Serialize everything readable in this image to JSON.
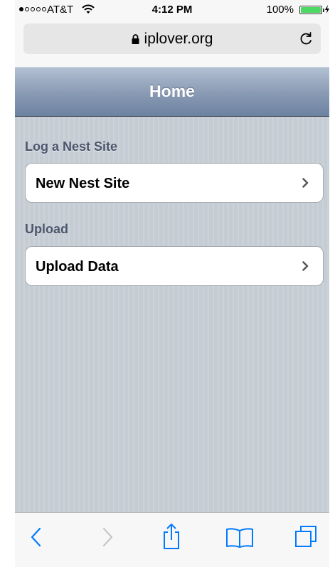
{
  "status_bar": {
    "carrier": "AT&T",
    "time": "4:12 PM",
    "battery_percent": "100%",
    "battery_level": 1.0,
    "signal_filled": 1,
    "signal_total": 5
  },
  "address_bar": {
    "url": "iplover.org",
    "lock_icon": "lock-icon",
    "reload_icon": "reload-icon"
  },
  "header": {
    "title": "Home"
  },
  "sections": [
    {
      "header": "Log a Nest Site",
      "item_label": "New Nest Site"
    },
    {
      "header": "Upload",
      "item_label": "Upload Data"
    }
  ],
  "toolbar": {
    "buttons": [
      "back-icon",
      "forward-icon",
      "share-icon",
      "bookmarks-icon",
      "tabs-icon"
    ]
  },
  "colors": {
    "accent": "#007aff",
    "disabled": "#c7c7cc",
    "section_text": "#4c566c",
    "header_gradient_top": "#b2c0d2",
    "header_gradient_bottom": "#6d82a1",
    "content_bg": "#c5ccd4",
    "battery_fill": "#4cd964"
  }
}
